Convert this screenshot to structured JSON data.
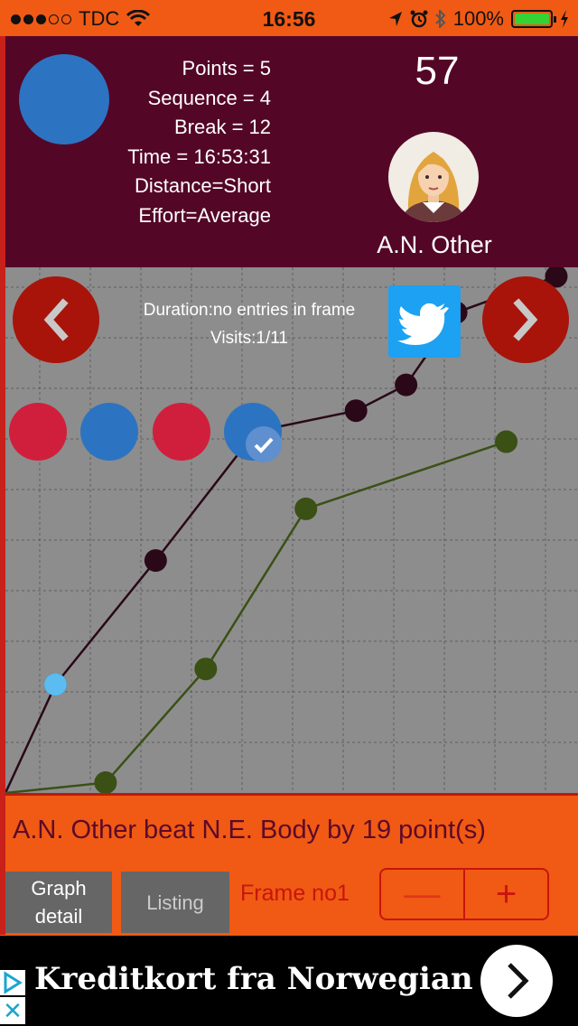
{
  "status_bar": {
    "carrier": "TDC",
    "time": "16:56",
    "battery": "100%",
    "signal_bars_filled": 3,
    "signal_bars_total": 5
  },
  "header": {
    "player_color": "#2c74c1",
    "stats": [
      "Points = 5",
      "Sequence = 4",
      "Break = 12",
      "Time = 16:53:31",
      "Distance=Short",
      "Effort=Average"
    ],
    "score": "57",
    "player_name": "A.N. Other"
  },
  "graph": {
    "info_line1": "Duration:no entries in frame",
    "info_line2": "Visits:1/11",
    "sequence_balls": [
      {
        "color": "#d01f3c",
        "selected": false
      },
      {
        "color": "#2c74c1",
        "selected": false
      },
      {
        "color": "#d01f3c",
        "selected": false
      },
      {
        "color": "#2c74c1",
        "selected": true
      }
    ],
    "colors": {
      "line_player": "#2a0818",
      "dot_player": "#2a0818",
      "line_opponent": "#3a5015",
      "dot_opponent": "#3a5015",
      "highlight": "#5bbcf0"
    }
  },
  "chart_data": {
    "type": "line",
    "title": "",
    "xlabel": "",
    "ylabel": "",
    "grid": true,
    "series": [
      {
        "values": [
          {
            "x": 0,
            "y": 0
          },
          {
            "x": 1,
            "y": 21
          },
          {
            "x": 3,
            "y": 45
          },
          {
            "x": 5,
            "y": 70
          },
          {
            "x": 7,
            "y": 74
          },
          {
            "x": 8,
            "y": 79
          },
          {
            "x": 9,
            "y": 93
          },
          {
            "x": 11,
            "y": 100
          }
        ]
      },
      {
        "values": [
          {
            "x": 0,
            "y": 0
          },
          {
            "x": 2,
            "y": 2
          },
          {
            "x": 4,
            "y": 24
          },
          {
            "x": 6,
            "y": 55
          },
          {
            "x": 10,
            "y": 68
          }
        ]
      }
    ]
  },
  "bottom": {
    "result_text": "A.N. Other beat N.E. Body by 19 point(s)",
    "graph_detail_line1": "Graph",
    "graph_detail_line2": "detail",
    "listing_label": "Listing",
    "frame_label": "Frame no1",
    "minus_label": "—",
    "plus_label": "+"
  },
  "ad": {
    "title": "Kreditkort fra Norwegian",
    "close_label": "✕"
  }
}
